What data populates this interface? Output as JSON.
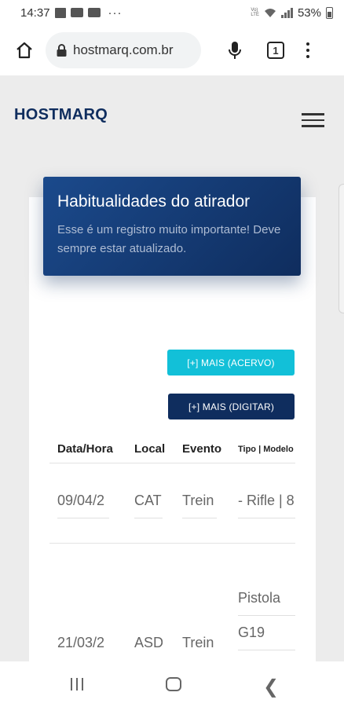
{
  "status_bar": {
    "time": "14:37",
    "more": "···",
    "network": "Vo)\nLTE",
    "battery": "53%"
  },
  "browser": {
    "url": "hostmarq.com.br",
    "tab_count": "1"
  },
  "site": {
    "brand": "HOSTMARQ"
  },
  "panel": {
    "title": "Habitualidades do atirador",
    "subtitle": "Esse é um registro muito importante! Deve sempre estar atualizado."
  },
  "actions": {
    "acervo_label": "[+] MAIS (ACERVO)",
    "digitar_label": "[+] MAIS (DIGITAR)"
  },
  "table": {
    "columns": [
      "Data/Hora",
      "Local",
      "Evento",
      "Tipo | Modelo"
    ],
    "rows": [
      {
        "date": "09/04/2",
        "local": "CAT",
        "evento": "Trein",
        "tipo": [
          "- Rifle | 8"
        ]
      },
      {
        "date": "21/03/2",
        "local": "ASD",
        "evento": "Trein",
        "tipo": [
          "Pistola",
          "G19"
        ]
      }
    ]
  },
  "colors": {
    "brand_navy": "#0f2d5e",
    "accent_cyan": "#12c0d8"
  }
}
